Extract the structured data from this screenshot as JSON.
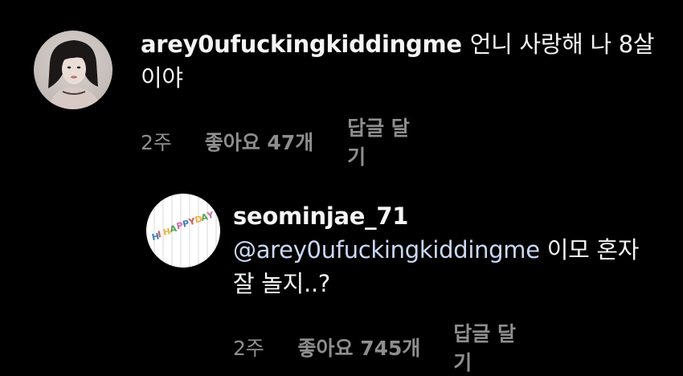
{
  "comments": [
    {
      "username": "arey0ufuckingkiddingme",
      "text": "언니 사랑해 나 8살이야",
      "time": "2주",
      "likes": "좋아요 47개",
      "reply_label": "답글 달기"
    }
  ],
  "replies": [
    {
      "username": "seominjae_71",
      "mention": "@arey0ufuckingkiddingme",
      "text": "이모 혼자 잘 놀지..?",
      "time": "2주",
      "likes": "좋아요 745개",
      "reply_label": "답글 달기",
      "avatar_text": "HI HAPPY DAY"
    }
  ],
  "colors": {
    "background": "#000000",
    "text": "#f5f5f5",
    "secondary": "#8e8e8e",
    "mention": "#c9d9f5"
  }
}
